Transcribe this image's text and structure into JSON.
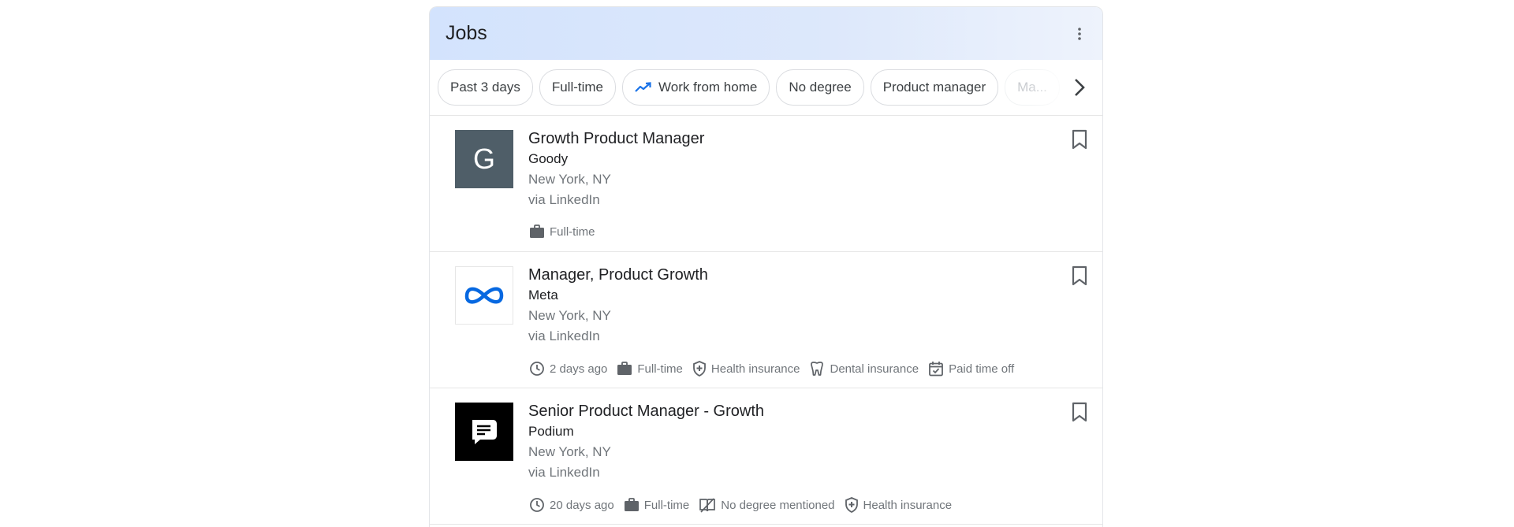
{
  "header": {
    "title": "Jobs"
  },
  "filters": [
    {
      "label": "Past 3 days",
      "icon": ""
    },
    {
      "label": "Full-time",
      "icon": ""
    },
    {
      "label": "Work from home",
      "icon": "trending-up-icon"
    },
    {
      "label": "No degree",
      "icon": ""
    },
    {
      "label": "Product manager",
      "icon": ""
    },
    {
      "label": "Ma...",
      "icon": ""
    }
  ],
  "jobs": [
    {
      "title": "Growth Product Manager",
      "company": "Goody",
      "location": "New York, NY",
      "via": "via LinkedIn",
      "logo": {
        "letter": "G",
        "color": "#4f5e68"
      },
      "tags": [
        {
          "icon": "briefcase-icon",
          "label": "Full-time"
        }
      ]
    },
    {
      "title": "Manager, Product Growth",
      "company": "Meta",
      "location": "New York, NY",
      "via": "via LinkedIn",
      "logo": {
        "color": "#0668e1"
      },
      "tags": [
        {
          "icon": "clock-icon",
          "label": "2 days ago"
        },
        {
          "icon": "briefcase-icon",
          "label": "Full-time"
        },
        {
          "icon": "shield-icon",
          "label": "Health insurance"
        },
        {
          "icon": "tooth-icon",
          "label": "Dental insurance"
        },
        {
          "icon": "calendar-check-icon",
          "label": "Paid time off"
        }
      ]
    },
    {
      "title": "Senior Product Manager - Growth",
      "company": "Podium",
      "location": "New York, NY",
      "via": "via LinkedIn",
      "logo": {
        "color": "#000000"
      },
      "tags": [
        {
          "icon": "clock-icon",
          "label": "20 days ago"
        },
        {
          "icon": "briefcase-icon",
          "label": "Full-time"
        },
        {
          "icon": "degree-icon",
          "label": "No degree mentioned"
        },
        {
          "icon": "shield-icon",
          "label": "Health insurance"
        }
      ]
    }
  ],
  "colors": {
    "header_gradient_start": "#d3e3fd",
    "trend_blue": "#1a73e8",
    "meta_blue": "#0668e1"
  }
}
